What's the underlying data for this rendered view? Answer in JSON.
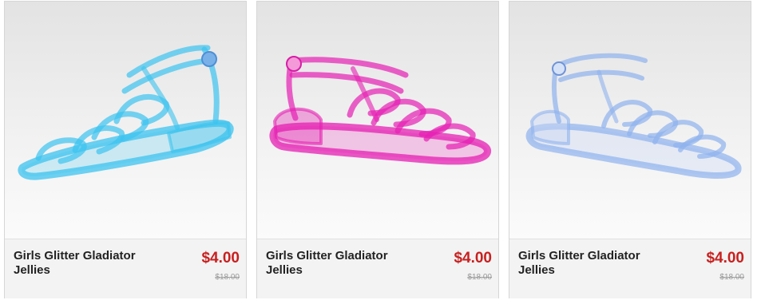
{
  "products": [
    {
      "name": "Girls Glitter Gladiator Jellies",
      "price": "$4.00",
      "original_price": "$18.00",
      "color": "#3cc3ef",
      "image": "blue-glitter-gladiator-jelly-sandal"
    },
    {
      "name": "Girls Glitter Gladiator Jellies",
      "price": "$4.00",
      "original_price": "$18.00",
      "color": "#e61fb3",
      "image": "pink-glitter-gladiator-jelly-sandal"
    },
    {
      "name": "Girls Glitter Gladiator Jellies",
      "price": "$4.00",
      "original_price": "$18.00",
      "color": "#8fb2ee",
      "image": "clear-glitter-gladiator-jelly-sandal"
    }
  ],
  "colors": {
    "sale_price": "#c8201f",
    "original_price": "#9a9a9a",
    "name": "#222222"
  }
}
